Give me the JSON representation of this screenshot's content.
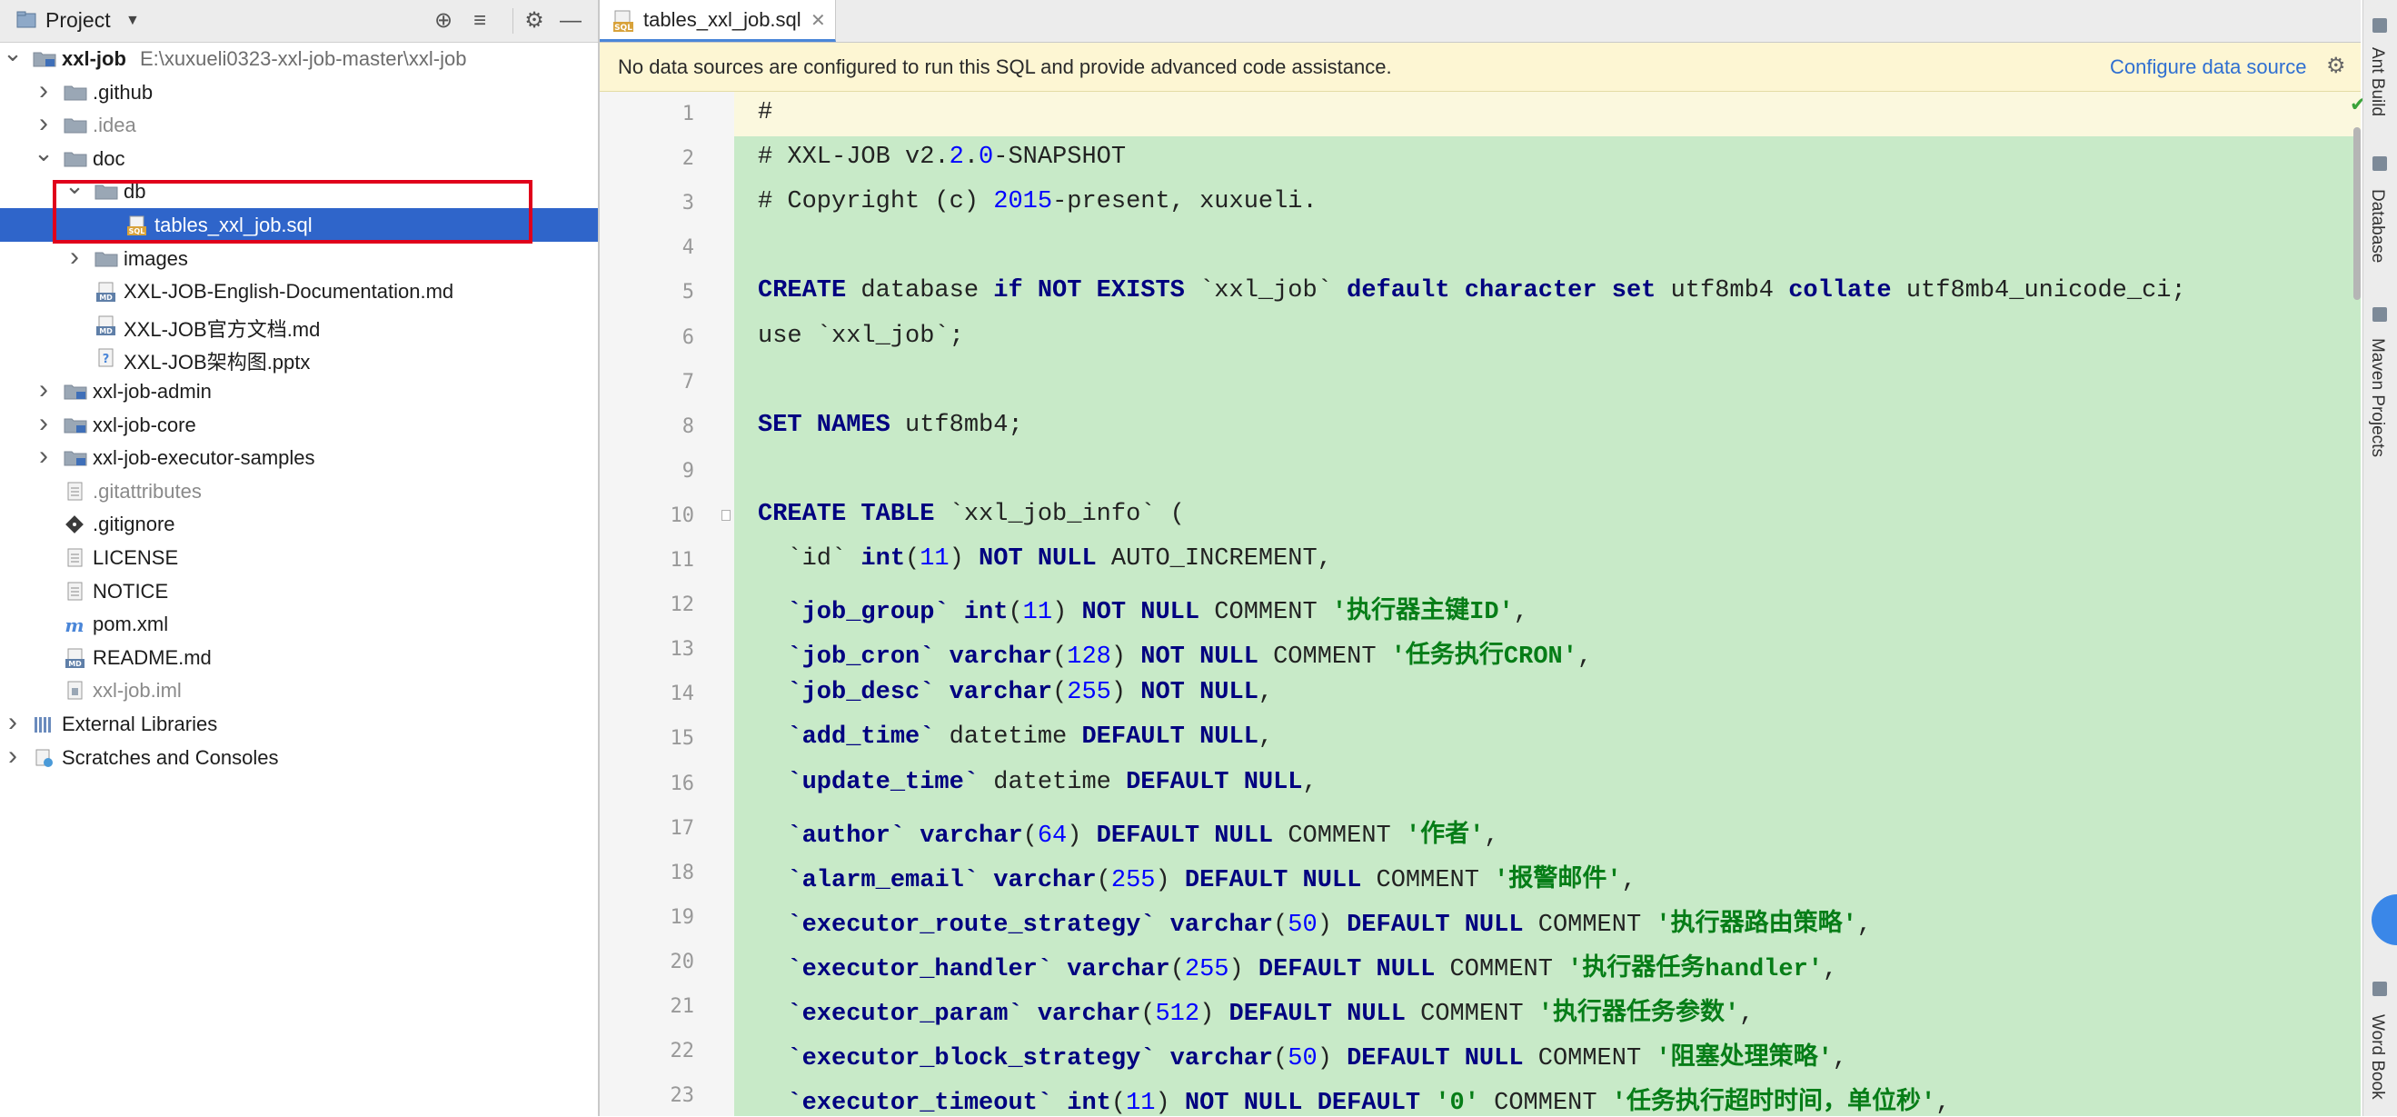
{
  "project_panel": {
    "title": "Project",
    "tree": [
      {
        "id": "root",
        "label": "xxl-job",
        "path": "E:\\xuxueli0323-xxl-job-master\\xxl-job",
        "level": 0,
        "expanded": true,
        "type": "module",
        "bold": true
      },
      {
        "id": "github",
        "label": ".github",
        "level": 1,
        "expanded": false,
        "type": "folder"
      },
      {
        "id": "idea",
        "label": ".idea",
        "level": 1,
        "expanded": false,
        "type": "folder",
        "dim": true
      },
      {
        "id": "doc",
        "label": "doc",
        "level": 1,
        "expanded": true,
        "type": "folder"
      },
      {
        "id": "db",
        "label": "db",
        "level": 2,
        "expanded": true,
        "type": "folder"
      },
      {
        "id": "tables_sql",
        "label": "tables_xxl_job.sql",
        "level": 3,
        "type": "sql",
        "selected": true
      },
      {
        "id": "images",
        "label": "images",
        "level": 2,
        "expanded": false,
        "type": "folder"
      },
      {
        "id": "doc_en",
        "label": "XXL-JOB-English-Documentation.md",
        "level": 2,
        "type": "md"
      },
      {
        "id": "doc_cn",
        "label": "XXL-JOB官方文档.md",
        "level": 2,
        "type": "md"
      },
      {
        "id": "doc_pptx",
        "label": "XXL-JOB架构图.pptx",
        "level": 2,
        "type": "unknown"
      },
      {
        "id": "admin",
        "label": "xxl-job-admin",
        "level": 1,
        "expanded": false,
        "type": "module"
      },
      {
        "id": "core",
        "label": "xxl-job-core",
        "level": 1,
        "expanded": false,
        "type": "module"
      },
      {
        "id": "samples",
        "label": "xxl-job-executor-samples",
        "level": 1,
        "expanded": false,
        "type": "module"
      },
      {
        "id": "gitattributes",
        "label": ".gitattributes",
        "level": 1,
        "type": "text",
        "dim": true
      },
      {
        "id": "gitignore",
        "label": ".gitignore",
        "level": 1,
        "type": "git"
      },
      {
        "id": "license",
        "label": "LICENSE",
        "level": 1,
        "type": "text"
      },
      {
        "id": "notice",
        "label": "NOTICE",
        "level": 1,
        "type": "text"
      },
      {
        "id": "pom",
        "label": "pom.xml",
        "level": 1,
        "type": "maven"
      },
      {
        "id": "readme",
        "label": "README.md",
        "level": 1,
        "type": "md"
      },
      {
        "id": "iml",
        "label": "xxl-job.iml",
        "level": 1,
        "type": "iml",
        "dim": true
      },
      {
        "id": "extlibs",
        "label": "External Libraries",
        "level": 0,
        "expanded": false,
        "type": "libs"
      },
      {
        "id": "scratches",
        "label": "Scratches and Consoles",
        "level": 0,
        "expanded": false,
        "type": "scratch"
      }
    ]
  },
  "editor": {
    "tab_label": "tables_xxl_job.sql",
    "banner_text": "No data sources are configured to run this SQL and provide advanced code assistance.",
    "banner_link": "Configure data source",
    "lines": [
      [
        [
          "c",
          "#"
        ]
      ],
      [
        [
          "c",
          "# XXL-JOB v2."
        ],
        [
          "n",
          "2"
        ],
        [
          "c",
          "."
        ],
        [
          "n",
          "0"
        ],
        [
          "c",
          "-SNAPSHOT"
        ]
      ],
      [
        [
          "c",
          "# Copyright (c) "
        ],
        [
          "n",
          "2015"
        ],
        [
          "c",
          "-present, xuxueli."
        ]
      ],
      [],
      [
        [
          "k",
          "CREATE "
        ],
        [
          "c",
          "database "
        ],
        [
          "k",
          "if NOT EXISTS "
        ],
        [
          "c",
          "`xxl_job` "
        ],
        [
          "k",
          "default character set "
        ],
        [
          "c",
          "utf8mb4 "
        ],
        [
          "k",
          "collate "
        ],
        [
          "c",
          "utf8mb4_unicode_ci;"
        ]
      ],
      [
        [
          "c",
          "use `xxl_job`;"
        ]
      ],
      [],
      [
        [
          "k",
          "SET NAMES "
        ],
        [
          "c",
          "utf8mb4;"
        ]
      ],
      [],
      [
        [
          "k",
          "CREATE TABLE "
        ],
        [
          "c",
          "`xxl_job_info` ("
        ]
      ],
      [
        [
          "c",
          "  `id` "
        ],
        [
          "k",
          "int"
        ],
        [
          "c",
          "("
        ],
        [
          "n",
          "11"
        ],
        [
          "c",
          ") "
        ],
        [
          "k",
          "NOT NULL "
        ],
        [
          "c",
          "AUTO_INCREMENT,"
        ]
      ],
      [
        [
          "c",
          "  "
        ],
        [
          "k",
          "`job_group` int"
        ],
        [
          "c",
          "("
        ],
        [
          "n",
          "11"
        ],
        [
          "c",
          ") "
        ],
        [
          "k",
          "NOT NULL "
        ],
        [
          "c",
          "COMMENT "
        ],
        [
          "s",
          "'执行器主键ID'"
        ],
        [
          "c",
          ","
        ]
      ],
      [
        [
          "c",
          "  "
        ],
        [
          "k",
          "`job_cron` varchar"
        ],
        [
          "c",
          "("
        ],
        [
          "n",
          "128"
        ],
        [
          "c",
          ") "
        ],
        [
          "k",
          "NOT NULL "
        ],
        [
          "c",
          "COMMENT "
        ],
        [
          "s",
          "'任务执行CRON'"
        ],
        [
          "c",
          ","
        ]
      ],
      [
        [
          "c",
          "  "
        ],
        [
          "k",
          "`job_desc` varchar"
        ],
        [
          "c",
          "("
        ],
        [
          "n",
          "255"
        ],
        [
          "c",
          ") "
        ],
        [
          "k",
          "NOT NULL"
        ],
        [
          "c",
          ","
        ]
      ],
      [
        [
          "c",
          "  "
        ],
        [
          "k",
          "`add_time` "
        ],
        [
          "c",
          "datetime "
        ],
        [
          "k",
          "DEFAULT NULL"
        ],
        [
          "c",
          ","
        ]
      ],
      [
        [
          "c",
          "  "
        ],
        [
          "k",
          "`update_time` "
        ],
        [
          "c",
          "datetime "
        ],
        [
          "k",
          "DEFAULT NULL"
        ],
        [
          "c",
          ","
        ]
      ],
      [
        [
          "c",
          "  "
        ],
        [
          "k",
          "`author` varchar"
        ],
        [
          "c",
          "("
        ],
        [
          "n",
          "64"
        ],
        [
          "c",
          ") "
        ],
        [
          "k",
          "DEFAULT NULL "
        ],
        [
          "c",
          "COMMENT "
        ],
        [
          "s",
          "'作者'"
        ],
        [
          "c",
          ","
        ]
      ],
      [
        [
          "c",
          "  "
        ],
        [
          "k",
          "`alarm_email` varchar"
        ],
        [
          "c",
          "("
        ],
        [
          "n",
          "255"
        ],
        [
          "c",
          ") "
        ],
        [
          "k",
          "DEFAULT NULL "
        ],
        [
          "c",
          "COMMENT "
        ],
        [
          "s",
          "'报警邮件'"
        ],
        [
          "c",
          ","
        ]
      ],
      [
        [
          "c",
          "  "
        ],
        [
          "k",
          "`executor_route_strategy` varchar"
        ],
        [
          "c",
          "("
        ],
        [
          "n",
          "50"
        ],
        [
          "c",
          ") "
        ],
        [
          "k",
          "DEFAULT NULL "
        ],
        [
          "c",
          "COMMENT "
        ],
        [
          "s",
          "'执行器路由策略'"
        ],
        [
          "c",
          ","
        ]
      ],
      [
        [
          "c",
          "  "
        ],
        [
          "k",
          "`executor_handler` varchar"
        ],
        [
          "c",
          "("
        ],
        [
          "n",
          "255"
        ],
        [
          "c",
          ") "
        ],
        [
          "k",
          "DEFAULT NULL "
        ],
        [
          "c",
          "COMMENT "
        ],
        [
          "s",
          "'执行器任务handler'"
        ],
        [
          "c",
          ","
        ]
      ],
      [
        [
          "c",
          "  "
        ],
        [
          "k",
          "`executor_param` varchar"
        ],
        [
          "c",
          "("
        ],
        [
          "n",
          "512"
        ],
        [
          "c",
          ") "
        ],
        [
          "k",
          "DEFAULT NULL "
        ],
        [
          "c",
          "COMMENT "
        ],
        [
          "s",
          "'执行器任务参数'"
        ],
        [
          "c",
          ","
        ]
      ],
      [
        [
          "c",
          "  "
        ],
        [
          "k",
          "`executor_block_strategy` varchar"
        ],
        [
          "c",
          "("
        ],
        [
          "n",
          "50"
        ],
        [
          "c",
          ") "
        ],
        [
          "k",
          "DEFAULT NULL "
        ],
        [
          "c",
          "COMMENT "
        ],
        [
          "s",
          "'阻塞处理策略'"
        ],
        [
          "c",
          ","
        ]
      ],
      [
        [
          "c",
          "  "
        ],
        [
          "k",
          "`executor_timeout` int"
        ],
        [
          "c",
          "("
        ],
        [
          "n",
          "11"
        ],
        [
          "c",
          ") "
        ],
        [
          "k",
          "NOT NULL DEFAULT "
        ],
        [
          "s",
          "'0'"
        ],
        [
          "c",
          " COMMENT "
        ],
        [
          "s",
          "'任务执行超时时间，单位秒'"
        ],
        [
          "c",
          ","
        ]
      ]
    ]
  },
  "right_tools": [
    {
      "id": "ant-build",
      "label": "Ant Build"
    },
    {
      "id": "database",
      "label": "Database"
    },
    {
      "id": "maven-projects",
      "label": "Maven Projects"
    },
    {
      "id": "word-book",
      "label": "Word Book"
    }
  ]
}
